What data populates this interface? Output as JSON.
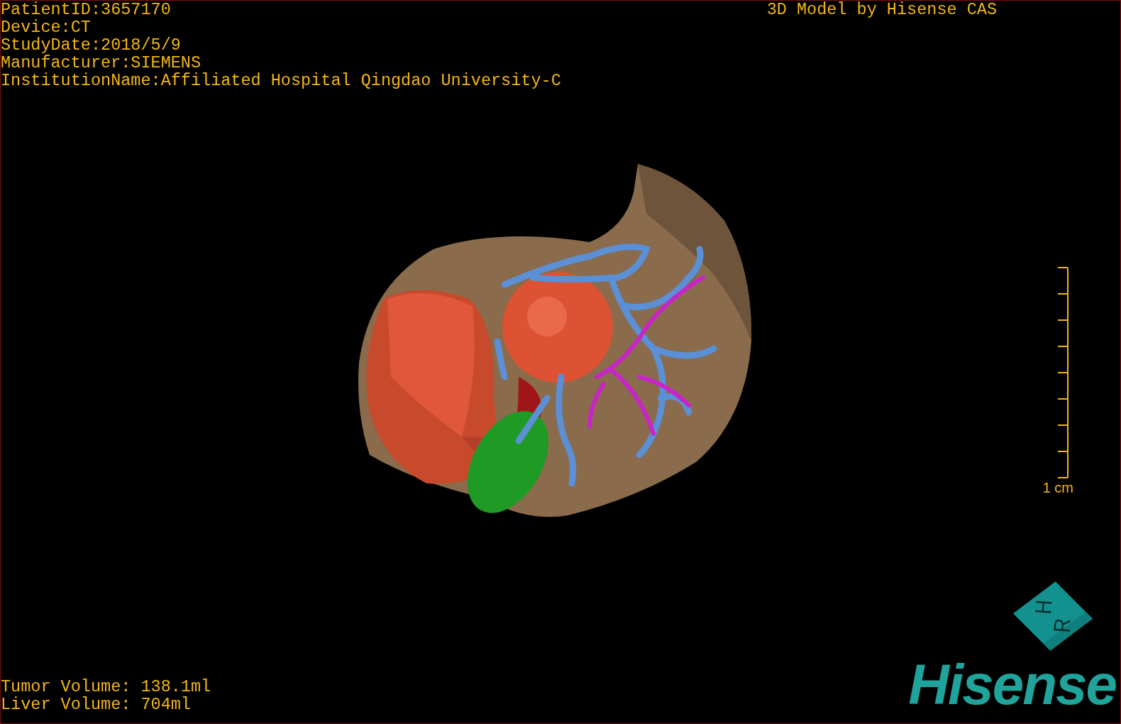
{
  "study_info": [
    "PatientID:3657170",
    "Device:CT",
    "StudyDate:2018/5/9",
    "Manufacturer:SIEMENS",
    "InstitutionName:Affiliated Hospital Qingdao University-C"
  ],
  "caption": "3D Model by Hisense CAS",
  "scale_bar": {
    "label": "1 cm"
  },
  "volumes": [
    "Tumor Volume: 138.1ml",
    "Liver Volume: 704ml"
  ],
  "orientation_cube": {
    "faces": [
      "H",
      "R"
    ]
  },
  "logo": "Hisense"
}
